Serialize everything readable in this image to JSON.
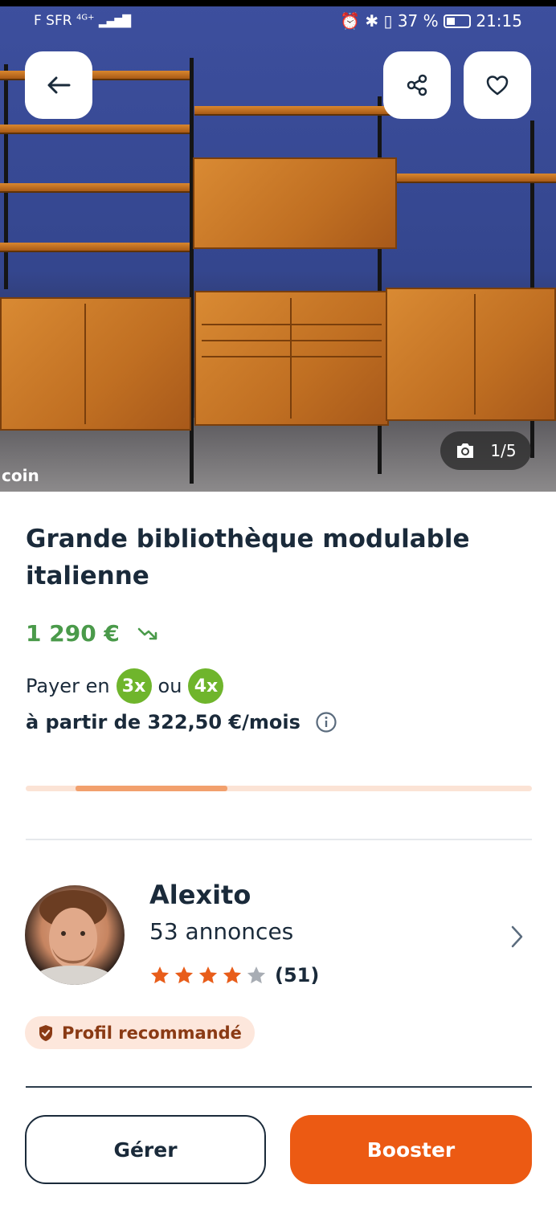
{
  "status_bar": {
    "carrier": "F SFR",
    "network": "4G+",
    "battery": "37 %",
    "time": "21:15"
  },
  "photo": {
    "counter": "1/5",
    "watermark": "coin"
  },
  "listing": {
    "title": "Grande bibliothèque modulable italienne",
    "price": "1 290 €",
    "pay_prefix": "Payer en",
    "pay_option_1": "3x",
    "pay_or": "ou",
    "pay_option_2": "4x",
    "monthly": "à partir de 322,50 €/mois"
  },
  "progress": {
    "fill_fraction": 0.3
  },
  "seller": {
    "name": "Alexito",
    "ads": "53 annonces",
    "rating_stars": 4,
    "rating_max": 5,
    "rating_count": "(51)",
    "badge": "Profil recommandé"
  },
  "actions": {
    "manage": "Gérer",
    "boost": "Booster"
  },
  "colors": {
    "price_green": "#4a9a4a",
    "accent_orange": "#ec5a13",
    "pill_green": "#6fb52c",
    "star_orange": "#e85d1a",
    "text_dark": "#1a2a3a"
  }
}
